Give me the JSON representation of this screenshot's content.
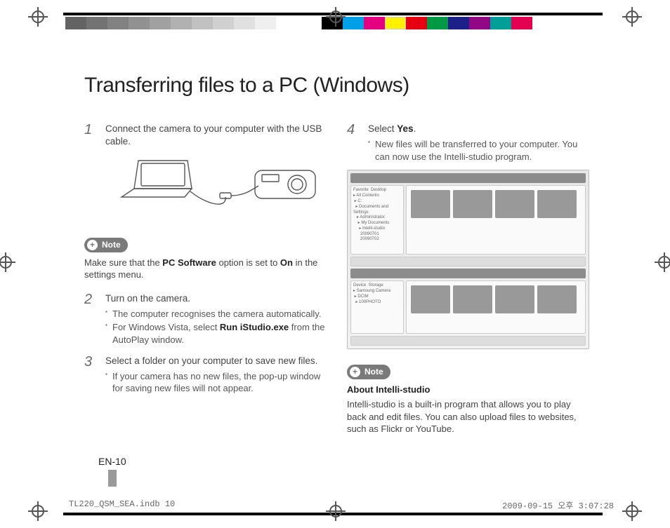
{
  "title": "Transferring files to a PC (Windows)",
  "left": {
    "step1": {
      "num": "1",
      "text": "Connect the camera to your computer with the USB cable."
    },
    "note1": {
      "label": "Note",
      "text_pre": "Make sure that the ",
      "bold1": "PC Software",
      "text_mid": " option is set to ",
      "bold2": "On",
      "text_post": " in the settings menu."
    },
    "step2": {
      "num": "2",
      "text": "Turn on the camera.",
      "sub1": "The computer recognises the camera automatically.",
      "sub2_pre": "For Windows Vista, select ",
      "sub2_bold": "Run iStudio.exe",
      "sub2_post": " from the AutoPlay window."
    },
    "step3": {
      "num": "3",
      "text": "Select a folder on your computer to save new files.",
      "sub1": "If your camera has no new files, the pop-up window for saving new files will not appear."
    }
  },
  "right": {
    "step4": {
      "num": "4",
      "text_pre": "Select ",
      "bold": "Yes",
      "text_post": ".",
      "sub1": "New files will be transferred to your computer. You can now use the Intelli-studio program."
    },
    "note2": {
      "label": "Note",
      "heading": "About Intelli-studio",
      "body": "Intelli-studio is a built-in program that allows you to play back and edit files. You can also upload files to websites, such as Flickr or YouTube."
    }
  },
  "page_num": "EN-10",
  "footer_left": "TL220_QSM_SEA.indb   10",
  "footer_right": "2009-09-15   오후 3:07:28"
}
